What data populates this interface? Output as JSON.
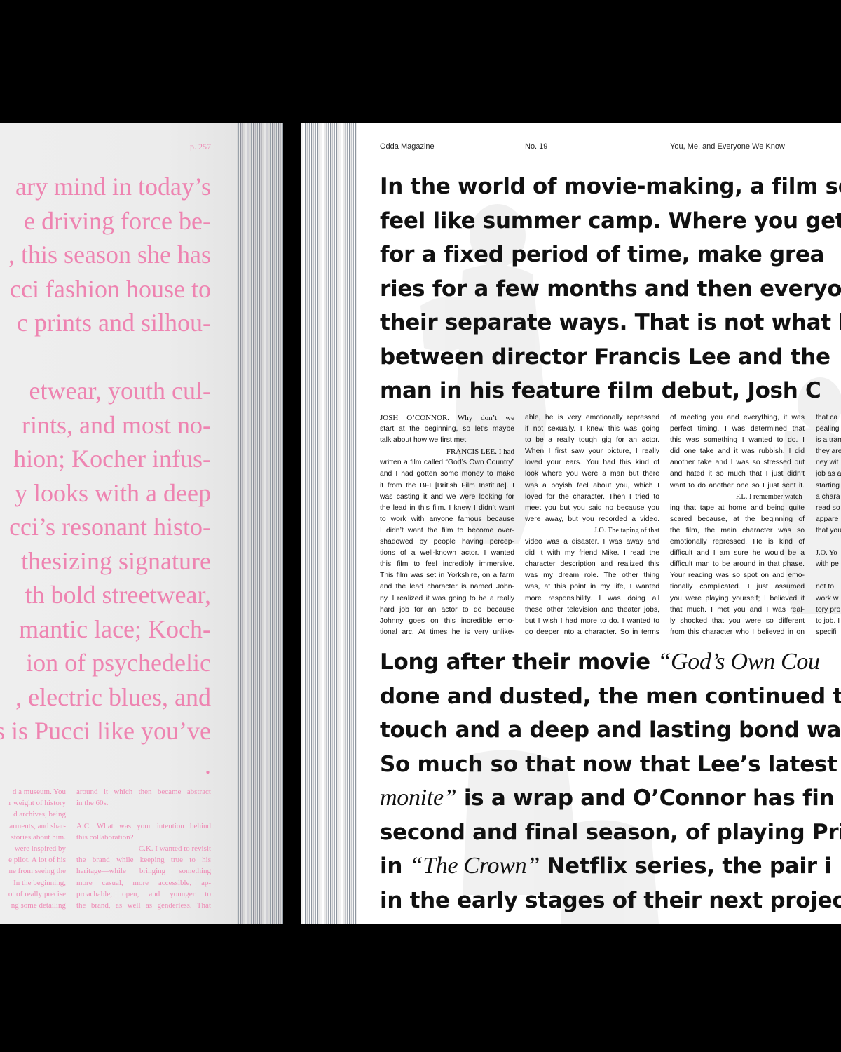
{
  "left_page": {
    "folio": "p.        257",
    "display_lines": [
      "ary mind in today’s",
      "e driving force be-",
      ", this season she has",
      "cci fashion house to",
      "c prints and silhou-",
      "",
      "etwear, youth cul-",
      "rints, and most no-",
      "hion; Kocher infus-",
      "y looks with a deep",
      "cci’s resonant histo-",
      "thesizing signature",
      "th bold streetwear,",
      "mantic lace; Koch-",
      "ion of psychedelic",
      ", electric blues, and",
      "s is Pucci like you’ve",
      "."
    ],
    "col1_lines": [
      "d a museum. You",
      "r weight of history",
      "d archives, being",
      "arments, and shar-",
      "stories about him.",
      "were inspired by",
      "e pilot. A lot of his",
      "ne from seeing the",
      "In the beginning,",
      "ot of really precise",
      "ng some detailing"
    ],
    "col2_lines": [
      "around it which then became abstract",
      "in the 60s.",
      "",
      "A.C. What was your intention behind",
      "this collaboration?",
      "C.K. I wanted to revisit",
      "the brand while keeping true to his",
      "heritage—while bringing something",
      "more casual, more accessible, ap-",
      "proachable, open, and younger to",
      "the brand, as well as genderless. That"
    ]
  },
  "right_page": {
    "running_head": {
      "magazine": "Odda Magazine",
      "issue": "No. 19",
      "title": "You, Me, and Everyone We Know"
    },
    "headline_lines": [
      "In the world of movie-making, a film set",
      "feel like summer camp. Where you get",
      "for a fixed period of time, make grea",
      "ries for a few months and then everyo",
      "their separate ways. That is not what h",
      "between director Francis Lee and the",
      "man in his feature film debut, Josh C"
    ],
    "body_col1": [
      "JOSH O’CONNOR. Why don’t we",
      "start at the beginning, so let’s maybe",
      "talk about how we first met.",
      "FRANCIS LEE. I had",
      "written a film called “God’s Own Country”",
      "and I had gotten some money to make",
      "it from the BFI [British Film Institute]. I",
      "was casting it and we were looking for",
      "the lead in this film. I knew I didn’t want",
      "to work with anyone famous because",
      "I didn’t want the film to become over-",
      "shadowed by people having percep-",
      "tions of a well-known actor. I wanted",
      "this film to feel incredibly immersive.",
      "This film was set in Yorkshire, on a farm",
      "and the lead character is named John-",
      "ny. I realized it was going to be a really",
      "hard job for an actor to do because",
      "Johnny goes on this incredible emo-",
      "tional arc. At times he is very unlike-"
    ],
    "body_col2": [
      "able, he is very emotionally repressed",
      "if not sexually. I knew this was going",
      "to be a really tough gig for an actor.",
      "When I first saw your picture, I really",
      "loved your ears. You had this kind of",
      "look where you were a man but there",
      "was a boyish feel about you, which I",
      "loved for the character. Then I tried to",
      "meet you but you said no because you",
      "were away, but you recorded a video.",
      "J.O. The taping of that",
      "video was a disaster. I was away and",
      "did it with my friend Mike. I read the",
      "character description and realized this",
      "was my dream role. The other thing",
      "was, at this point in my life, I wanted",
      "more responsibility. I was doing all",
      "these other television and theater jobs,",
      "but I wish I had more to do. I wanted to",
      "go deeper into a character. So in terms"
    ],
    "body_col3": [
      "of meeting you and everything, it was",
      "perfect timing. I was determined that",
      "this was something I wanted to do. I",
      "did one take and it was rubbish. I did",
      "another take and I was so stressed out",
      "and hated it so much that I just didn’t",
      "want to do another one so I just sent it.",
      "F.L. I remember watch-",
      "ing that tape at home and being quite",
      "scared because, at the beginning of",
      "the film, the main character was so",
      "emotionally repressed. He is kind of",
      "difficult and I am sure he would be a",
      "difficult man to be around in that phase.",
      "Your reading was so spot on and emo-",
      "tionally complicated. I just assumed",
      "you were playing yourself; I believed it",
      "that much. I met you and I was real-",
      "ly shocked that you were so different",
      "from this character who I believed in on"
    ],
    "body_col4": [
      "that ca",
      "pealing",
      "is a tran",
      "they are",
      "ney wit",
      "job as a",
      "starting",
      "a chara",
      "read so",
      "appare",
      "that you",
      "",
      "J.O. Yo",
      "with pe",
      "",
      "not to",
      "work w",
      "tory pro",
      "to job. I",
      "specifi"
    ],
    "pullquote": {
      "line1_a": "Long after their movie ",
      "line1_b": "“God’s Own Cou",
      "line2": "done and dusted, the men continued t",
      "line3": "touch and a deep and lasting bond was",
      "line4": "So much so that now that Lee’s latest mo",
      "line5_a": "monite”",
      "line5_b": " is a wrap and O’Connor has fin",
      "line6": "second and final season, of playing Princ",
      "line7_a": "in ",
      "line7_b": "“The Crown”",
      "line7_c": " Netflix series, the pair i",
      "line8": "in the early stages of their next project"
    }
  },
  "colors": {
    "background": "#000000",
    "pink_text": "#ee84b1",
    "left_paper": "#ececec",
    "right_paper": "#ffffff",
    "body_text": "#111111"
  }
}
